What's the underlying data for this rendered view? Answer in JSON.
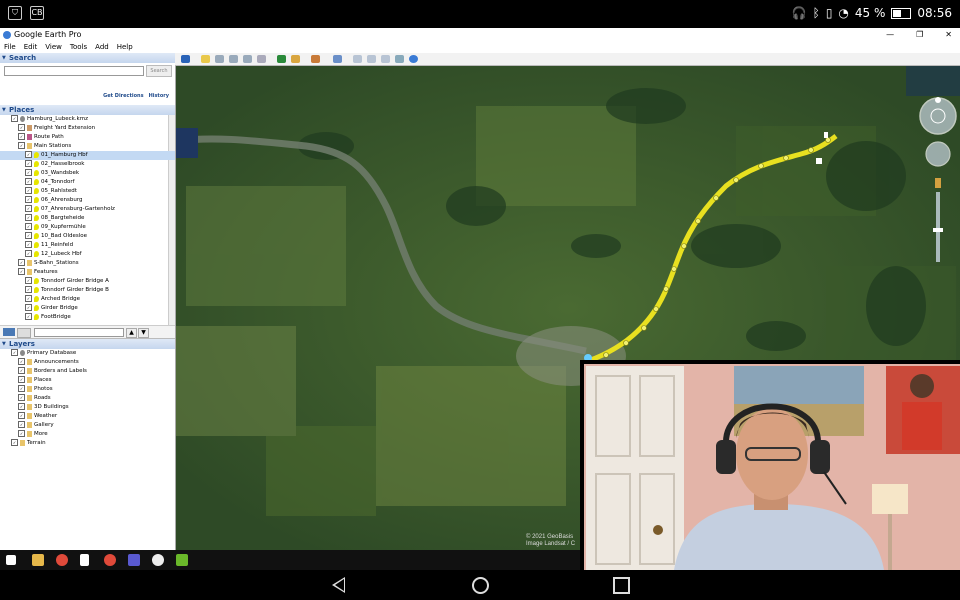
{
  "status_bar": {
    "left_icons": [
      "shield-icon",
      "screenshot-badge-icon"
    ],
    "badge_text": "CB",
    "battery_percent": "45 %",
    "battery_level": 0.45,
    "time": "08:56"
  },
  "window": {
    "title": "Google Earth Pro",
    "controls": [
      "—",
      "❐",
      "✕"
    ]
  },
  "menu": [
    "File",
    "Edit",
    "View",
    "Tools",
    "Add",
    "Help"
  ],
  "search": {
    "header": "Search",
    "button": "Search",
    "get_directions": "Get Directions",
    "history": "History"
  },
  "places": {
    "header": "Places",
    "items": [
      {
        "label": "Hamburg_Lubeck.kmz",
        "indent": 1,
        "icon": "kml"
      },
      {
        "label": "Freight Yard Extension",
        "indent": 2,
        "icon": "net"
      },
      {
        "label": "Route Path",
        "indent": 2,
        "icon": "path"
      },
      {
        "label": "Main Stations",
        "indent": 2,
        "icon": "folder"
      },
      {
        "label": "01_Hamburg Hbf",
        "indent": 3,
        "icon": "pin",
        "selected": true
      },
      {
        "label": "02_Hasselbrook",
        "indent": 3,
        "icon": "pin"
      },
      {
        "label": "03_Wandsbek",
        "indent": 3,
        "icon": "pin"
      },
      {
        "label": "04_Tonndorf",
        "indent": 3,
        "icon": "pin"
      },
      {
        "label": "05_Rahlstedt",
        "indent": 3,
        "icon": "pin"
      },
      {
        "label": "06_Ahrensburg",
        "indent": 3,
        "icon": "pin"
      },
      {
        "label": "07_Ahrensburg-Gartenholz",
        "indent": 3,
        "icon": "pin"
      },
      {
        "label": "08_Bargteheide",
        "indent": 3,
        "icon": "pin"
      },
      {
        "label": "09_Kupfermühle",
        "indent": 3,
        "icon": "pin"
      },
      {
        "label": "10_Bad Oldesloe",
        "indent": 3,
        "icon": "pin"
      },
      {
        "label": "11_Reinfeld",
        "indent": 3,
        "icon": "pin"
      },
      {
        "label": "12_Lubeck Hbf",
        "indent": 3,
        "icon": "pin"
      },
      {
        "label": "S-Bahn_Stations",
        "indent": 2,
        "icon": "folder"
      },
      {
        "label": "Features",
        "indent": 2,
        "icon": "folder"
      },
      {
        "label": "Tonndorf Girder Bridge A",
        "indent": 3,
        "icon": "pin"
      },
      {
        "label": "Tonndorf Girder Bridge B",
        "indent": 3,
        "icon": "pin"
      },
      {
        "label": "Arched Bridge",
        "indent": 3,
        "icon": "pin"
      },
      {
        "label": "Girder Bridge",
        "indent": 3,
        "icon": "pin"
      },
      {
        "label": "FootBridge",
        "indent": 3,
        "icon": "pin"
      }
    ]
  },
  "layers": {
    "header": "Layers",
    "items": [
      {
        "label": "Primary Database",
        "indent": 1,
        "icon": "kml"
      },
      {
        "label": "Announcements",
        "indent": 2,
        "icon": "folder"
      },
      {
        "label": "Borders and Labels",
        "indent": 2,
        "icon": "folder"
      },
      {
        "label": "Places",
        "indent": 2,
        "icon": "folder"
      },
      {
        "label": "Photos",
        "indent": 2,
        "icon": "folder"
      },
      {
        "label": "Roads",
        "indent": 2,
        "icon": "folder"
      },
      {
        "label": "3D Buildings",
        "indent": 2,
        "icon": "folder"
      },
      {
        "label": "Weather",
        "indent": 2,
        "icon": "folder"
      },
      {
        "label": "Gallery",
        "indent": 2,
        "icon": "folder"
      },
      {
        "label": "More",
        "indent": 2,
        "icon": "folder"
      },
      {
        "label": "Terrain",
        "indent": 1,
        "icon": "folder"
      }
    ]
  },
  "map": {
    "attribution_1": "© 2021 GeoBasis",
    "attribution_2": "Image Landsat / C"
  },
  "taskbar_icons": [
    "windows-start-icon",
    "file-explorer-icon",
    "chrome-icon",
    "document-icon",
    "chrome-icon",
    "teams-icon",
    "unreal-icon",
    "nvidia-icon"
  ],
  "colors": {
    "route": "#e8e020",
    "map_dark": "#2c4a2a",
    "selection": "#c3d9f3"
  }
}
